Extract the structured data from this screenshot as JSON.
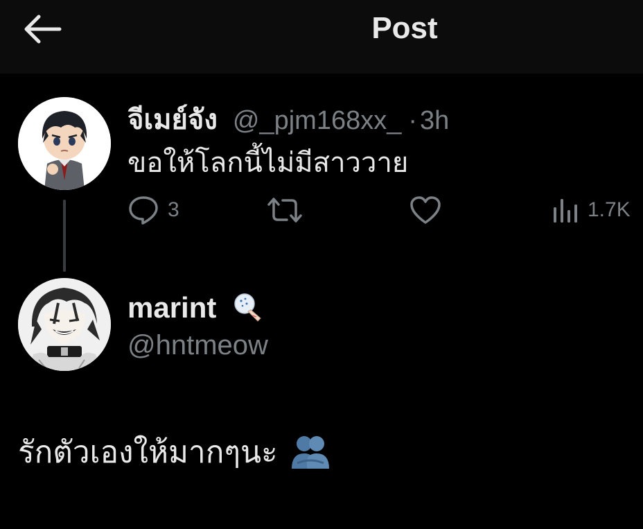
{
  "header": {
    "title": "Post",
    "back_icon": "arrow-left-icon"
  },
  "parent_post": {
    "display_name": "จีเมย์จัง",
    "handle": "@_pjm168xx_",
    "separator": "·",
    "time": "3h",
    "text": "ขอให้โลกนี้ไม่มีสาววาย",
    "actions": {
      "reply_count": "3",
      "retweet_count": "",
      "like_count": "",
      "views_count": "1.7K"
    },
    "avatar": "figurine-boy-avatar"
  },
  "reply_author": {
    "display_name": "marint",
    "handle": "@hntmeow",
    "badge": "paper-fan-emoji",
    "avatar": "anime-character-avatar"
  },
  "reply_post": {
    "text": "รักตัวเองให้มากๆนะ",
    "emoji": "people-hugging-emoji"
  },
  "colors": {
    "background": "#000000",
    "topbar": "#0c0c0c",
    "text_primary": "#e9e9e9",
    "text_secondary": "#7c8186",
    "thread_line": "#3a3d40"
  }
}
